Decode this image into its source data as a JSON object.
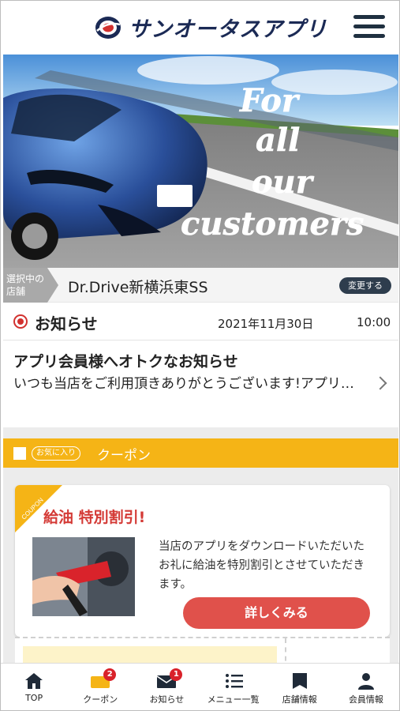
{
  "header": {
    "app_title": "サンオータスアプリ",
    "colors": {
      "brand_navy": "#1b2a55",
      "brand_red": "#d2312f"
    }
  },
  "hero": {
    "tagline_lines": [
      "For",
      "all",
      "our",
      "customers"
    ]
  },
  "store": {
    "tag_label": "選択中の店舗",
    "name": "Dr.Drive新横浜東SS",
    "change_label": "変更する"
  },
  "notice": {
    "section_title": "お知らせ",
    "date": "2021年11月30日",
    "time": "10:00",
    "item_title": "アプリ会員様へオトクなお知らせ",
    "item_body": "いつも当店をご利用頂きありがとうございます!アプリ…"
  },
  "coupon_section": {
    "favorite_label": "お気に入り",
    "title": "クーポン",
    "accent_color": "#f5b416"
  },
  "coupon": {
    "corner_label": "COUPON",
    "title": "給油 特別割引!",
    "description": "当店のアプリをダウンロードいただいたお礼に給油を特別割引とさせていただきます。",
    "detail_button": "詳しくみる"
  },
  "bottom_nav": {
    "items": [
      {
        "label": "TOP",
        "icon": "home-icon"
      },
      {
        "label": "クーポン",
        "icon": "coupon-icon",
        "badge": "2"
      },
      {
        "label": "お知らせ",
        "icon": "mail-icon",
        "badge": "1"
      },
      {
        "label": "メニュー一覧",
        "icon": "menu-list-icon"
      },
      {
        "label": "店舗情報",
        "icon": "store-icon"
      },
      {
        "label": "会員情報",
        "icon": "person-icon"
      }
    ]
  }
}
